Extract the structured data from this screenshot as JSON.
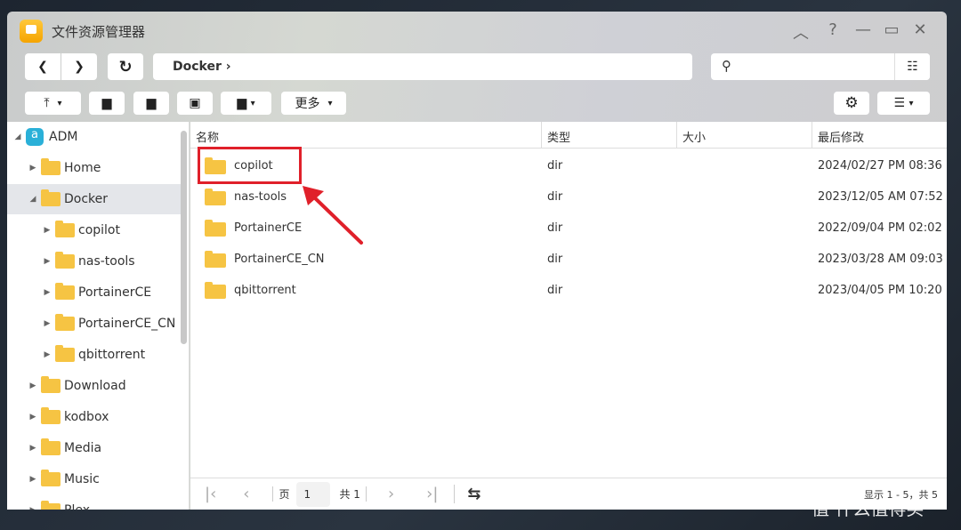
{
  "window": {
    "title": "文件资源管理器"
  },
  "nav": {
    "path": "Docker"
  },
  "toolbar": {
    "more_label": "更多"
  },
  "tree": {
    "root": "ADM",
    "items": [
      {
        "label": "Home",
        "level": 1,
        "selected": false
      },
      {
        "label": "Docker",
        "level": 1,
        "selected": true,
        "expanded": true
      },
      {
        "label": "copilot",
        "level": 2
      },
      {
        "label": "nas-tools",
        "level": 2
      },
      {
        "label": "PortainerCE",
        "level": 2
      },
      {
        "label": "PortainerCE_CN",
        "level": 2
      },
      {
        "label": "qbittorrent",
        "level": 2
      },
      {
        "label": "Download",
        "level": 1
      },
      {
        "label": "kodbox",
        "level": 1
      },
      {
        "label": "Media",
        "level": 1
      },
      {
        "label": "Music",
        "level": 1
      },
      {
        "label": "Plex",
        "level": 1
      }
    ]
  },
  "columns": [
    "名称",
    "类型",
    "大小",
    "最后修改"
  ],
  "files": [
    {
      "name": "copilot",
      "type": "dir",
      "size": "",
      "modified": "2024/02/27 PM 08:36",
      "highlighted": true
    },
    {
      "name": "nas-tools",
      "type": "dir",
      "size": "",
      "modified": "2023/12/05 AM 07:52"
    },
    {
      "name": "PortainerCE",
      "type": "dir",
      "size": "",
      "modified": "2022/09/04 PM 02:02"
    },
    {
      "name": "PortainerCE_CN",
      "type": "dir",
      "size": "",
      "modified": "2023/03/28 AM 09:03"
    },
    {
      "name": "qbittorrent",
      "type": "dir",
      "size": "",
      "modified": "2023/04/05 PM 10:20"
    }
  ],
  "pager": {
    "page_label": "页",
    "page": "1",
    "total_label": "共 1",
    "status": "显示 1 - 5，共 5"
  },
  "watermark": "值 什么值得买",
  "colors": {
    "highlight": "#e0202a",
    "folder": "#f6c443"
  }
}
